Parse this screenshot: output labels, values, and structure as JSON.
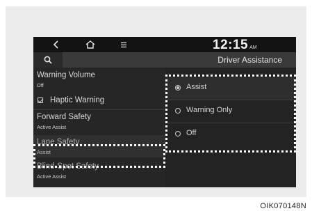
{
  "topbar": {
    "back_icon": "chevron-left-icon",
    "home_icon": "home-icon",
    "menu_icon": "menu-icon",
    "time": "12:15",
    "ampm": "AM"
  },
  "subbar": {
    "search_icon": "search-icon",
    "title": "Driver Assistance"
  },
  "left_menu": {
    "warning_volume": {
      "label": "Warning Volume",
      "value": "Off"
    },
    "haptic_warning": {
      "label": "Haptic Warning",
      "checked": true
    },
    "forward_safety": {
      "label": "Forward Safety",
      "value": "Active Assist"
    },
    "lane_safety": {
      "label": "Lane Safety",
      "value": "Assist"
    },
    "blind_spot_safety": {
      "label": "Blind-Spot Safety",
      "value": "Active Assist"
    }
  },
  "options": {
    "assist": {
      "label": "Assist",
      "selected": true
    },
    "warning_only": {
      "label": "Warning Only",
      "selected": false
    },
    "off": {
      "label": "Off",
      "selected": false
    }
  },
  "caption": "OIK070148N",
  "colors": {
    "highlight": "#ffffff",
    "screen_bg": "#1c1c1c",
    "frame_bg": "#ececec"
  }
}
